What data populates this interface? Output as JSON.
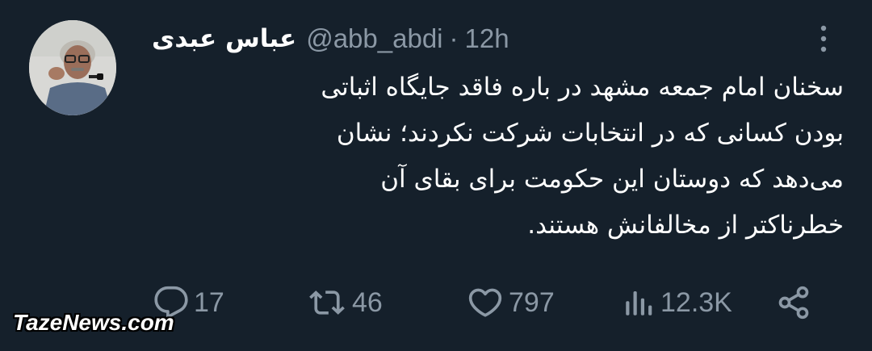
{
  "author": {
    "display_name": "عباس عبدی",
    "handle": "@abb_abdi",
    "separator": "·",
    "time": "12h"
  },
  "tweet": {
    "text": "سخنان امام جمعه مشهد در باره فاقد جایگاه اثباتی\nبودن کسانی که در انتخابات شرکت نکردند؛ نشان\nمی‌دهد که دوستان این حکومت برای بقای آن\nخطرناکتر از مخالفانش هستند."
  },
  "actions": {
    "replies": "17",
    "retweets": "46",
    "likes": "797",
    "views": "12.3K"
  },
  "icons": {
    "reply": "reply-icon",
    "retweet": "retweet-icon",
    "like": "heart-icon",
    "views": "views-icon",
    "share": "share-icon",
    "more": "more-vertical-icon"
  },
  "colors": {
    "background": "#15202b",
    "text": "#ffffff",
    "secondary": "#8b98a5"
  },
  "watermark": "TazeNews.com"
}
